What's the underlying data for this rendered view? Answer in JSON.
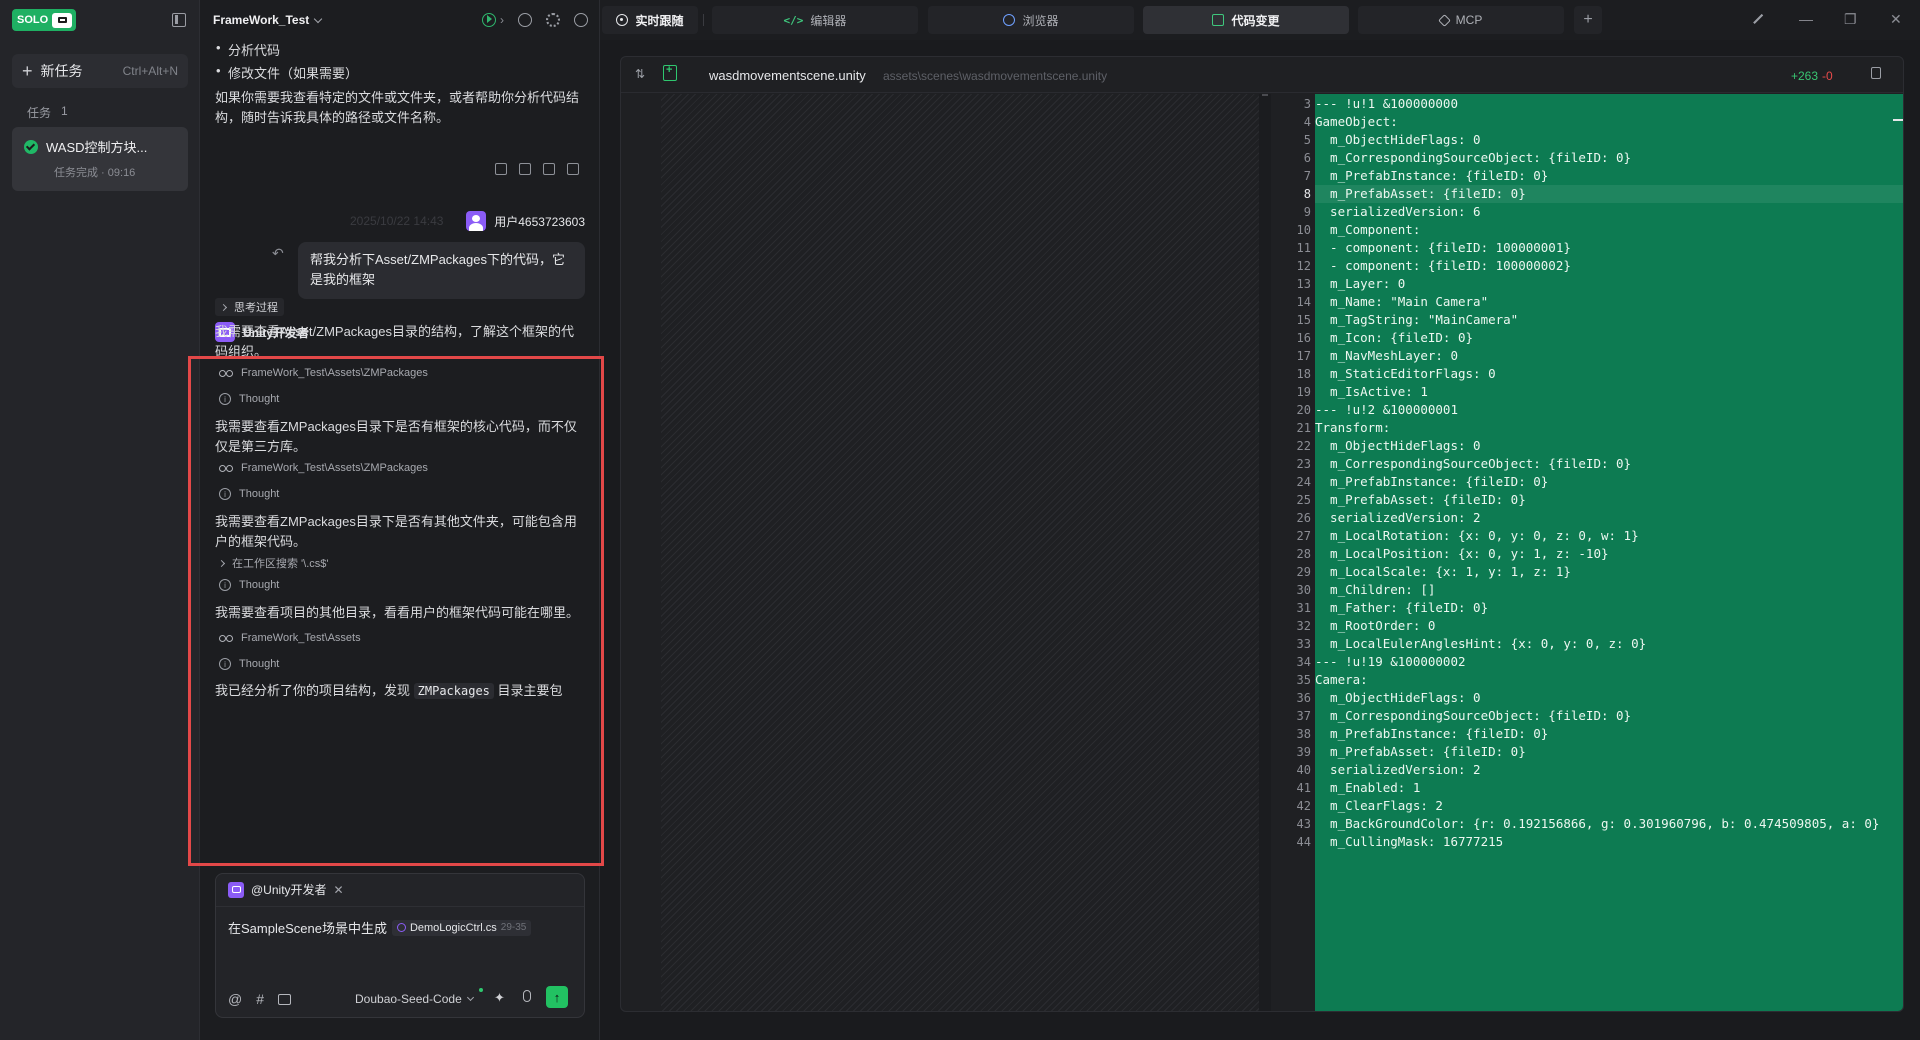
{
  "sidebar": {
    "logo_text": "SOLO",
    "new_task_label": "新任务",
    "new_task_shortcut": "Ctrl+Alt+N",
    "tasks_label": "任务",
    "tasks_count": "1",
    "task": {
      "title": "WASD控制方块...",
      "status": "任务完成 · 09:16"
    }
  },
  "chat": {
    "project_name": "FrameWork_Test",
    "bullets": [
      "分析代码",
      "修改文件（如果需要）"
    ],
    "intro_para": "如果你需要我查看特定的文件或文件夹，或者帮助你分析代码结构，随时告诉我具体的路径或文件名称。",
    "user_time": "2025/10/22 14:43",
    "user_name": "用户4653723603",
    "user_message": "帮我分析下Asset/ZMPackages下的代码，它是我的框架",
    "assistant_name": "Unity开发者",
    "think_label": "思考过程",
    "steps": [
      {
        "type": "text",
        "text": "我需要查看Asset/ZMPackages目录的结构，了解这个框架的代码组织。"
      },
      {
        "type": "view",
        "text": "FrameWork_Test\\Assets\\ZMPackages"
      },
      {
        "type": "thought",
        "text": "Thought"
      },
      {
        "type": "text",
        "text": "我需要查看ZMPackages目录下是否有框架的核心代码，而不仅仅是第三方库。"
      },
      {
        "type": "view",
        "text": "FrameWork_Test\\Assets\\ZMPackages"
      },
      {
        "type": "thought",
        "text": "Thought"
      },
      {
        "type": "text",
        "text": "我需要查看ZMPackages目录下是否有其他文件夹，可能包含用户的框架代码。"
      },
      {
        "type": "search",
        "text": "在工作区搜索 '\\.cs$'"
      },
      {
        "type": "thought",
        "text": "Thought"
      },
      {
        "type": "text",
        "text": "我需要查看项目的其他目录，看看用户的框架代码可能在哪里。"
      },
      {
        "type": "view",
        "text": "FrameWork_Test\\Assets"
      },
      {
        "type": "thought",
        "text": "Thought"
      }
    ],
    "final_pre": "我已经分析了你的项目结构，发现",
    "final_code": "ZMPackages",
    "final_post": "目录主要包",
    "composer": {
      "mention": "@Unity开发者",
      "text": "在SampleScene场景中生成",
      "file_chip": "DemoLogicCtrl.cs",
      "file_range": "29-35",
      "model": "Doubao-Seed-Code"
    }
  },
  "tabs": [
    {
      "label": "实时跟随",
      "icon": "live-icon"
    },
    {
      "label": "编辑器",
      "icon": "code-icon"
    },
    {
      "label": "浏览器",
      "icon": "browser-icon"
    },
    {
      "label": "代码变更",
      "icon": "diff-icon"
    },
    {
      "label": "MCP",
      "icon": "mcp-icon"
    }
  ],
  "active_tab": "代码变更",
  "editor": {
    "file_name": "wasdmovementscene.unity",
    "file_path": "assets\\scenes\\wasdmovementscene.unity",
    "additions": "+263",
    "deletions": "-0",
    "first_line_number": 3,
    "current_line": 8,
    "lines": [
      "--- !u!1 &100000000",
      "GameObject:",
      "  m_ObjectHideFlags: 0",
      "  m_CorrespondingSourceObject: {fileID: 0}",
      "  m_PrefabInstance: {fileID: 0}",
      "  m_PrefabAsset: {fileID: 0}",
      "  serializedVersion: 6",
      "  m_Component:",
      "  - component: {fileID: 100000001}",
      "  - component: {fileID: 100000002}",
      "  m_Layer: 0",
      "  m_Name: \"Main Camera\"",
      "  m_TagString: \"MainCamera\"",
      "  m_Icon: {fileID: 0}",
      "  m_NavMeshLayer: 0",
      "  m_StaticEditorFlags: 0",
      "  m_IsActive: 1",
      "--- !u!2 &100000001",
      "Transform:",
      "  m_ObjectHideFlags: 0",
      "  m_CorrespondingSourceObject: {fileID: 0}",
      "  m_PrefabInstance: {fileID: 0}",
      "  m_PrefabAsset: {fileID: 0}",
      "  serializedVersion: 2",
      "  m_LocalRotation: {x: 0, y: 0, z: 0, w: 1}",
      "  m_LocalPosition: {x: 0, y: 1, z: -10}",
      "  m_LocalScale: {x: 1, y: 1, z: 1}",
      "  m_Children: []",
      "  m_Father: {fileID: 0}",
      "  m_RootOrder: 0",
      "  m_LocalEulerAnglesHint: {x: 0, y: 0, z: 0}",
      "--- !u!19 &100000002",
      "Camera:",
      "  m_ObjectHideFlags: 0",
      "  m_CorrespondingSourceObject: {fileID: 0}",
      "  m_PrefabInstance: {fileID: 0}",
      "  m_PrefabAsset: {fileID: 0}",
      "  serializedVersion: 2",
      "  m_Enabled: 1",
      "  m_ClearFlags: 2",
      "  m_BackGroundColor: {r: 0.192156866, g: 0.301960796, b: 0.474509805, a: 0}",
      "  m_CullingMask: 16777215"
    ]
  },
  "colors": {
    "accent_green": "#1fb063",
    "diff_bg": "#0d7b52",
    "highlight_red": "#e34848",
    "avatar_purple": "#8b5cf6"
  }
}
